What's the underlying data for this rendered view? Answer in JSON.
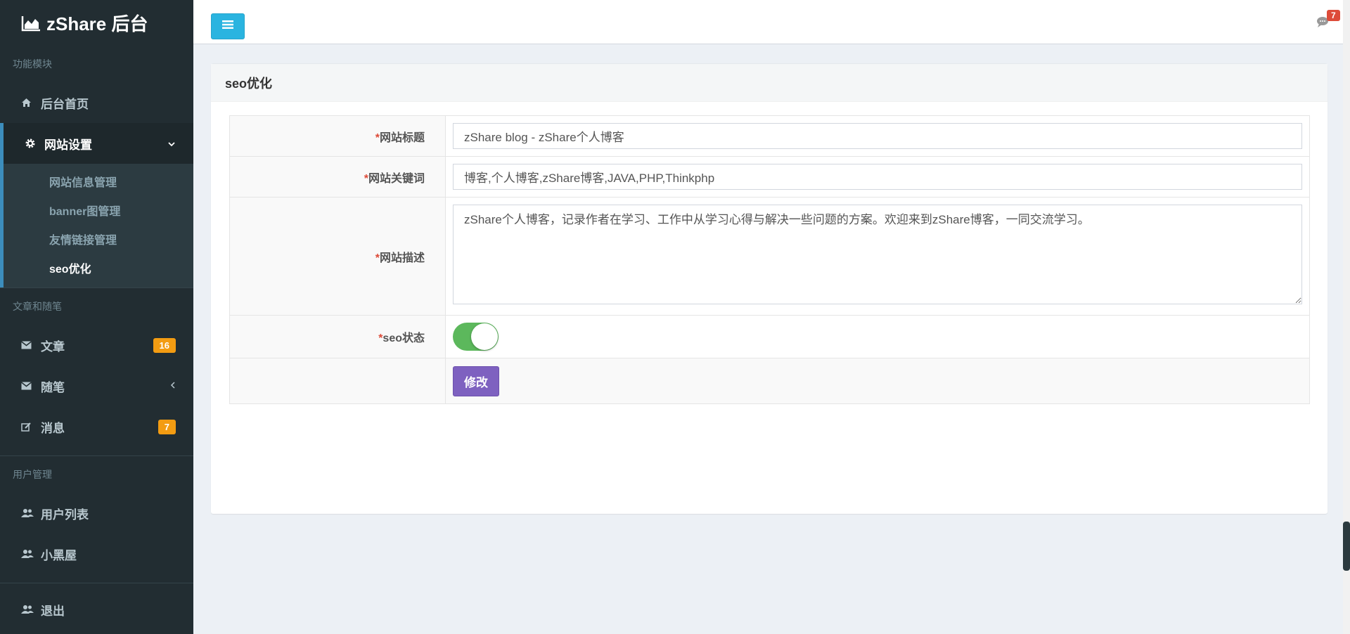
{
  "brand": {
    "title": "zShare 后台"
  },
  "sidebar": {
    "section1": "功能模块",
    "home": "后台首页",
    "site_settings": "网站设置",
    "submenu": [
      "网站信息管理",
      "banner图管理",
      "友情链接管理",
      "seo优化"
    ],
    "section2": "文章和随笔",
    "articles": {
      "label": "文章",
      "badge": "16"
    },
    "essays": "随笔",
    "messages": {
      "label": "消息",
      "badge": "7"
    },
    "section3": "用户管理",
    "users": "用户列表",
    "blacklist": "小黑屋",
    "logout": "退出"
  },
  "topbar": {
    "msg_count": "7"
  },
  "box": {
    "title": "seo优化"
  },
  "form": {
    "required_mark": "*",
    "site_title": {
      "label": "网站标题",
      "value": "zShare blog - zShare个人博客"
    },
    "keywords": {
      "label": "网站关键词",
      "value": "博客,个人博客,zShare博客,JAVA,PHP,Thinkphp"
    },
    "description": {
      "label": "网站描述",
      "value": "zShare个人博客，记录作者在学习、工作中从学习心得与解决一些问题的方案。欢迎来到zShare博客，一同交流学习。"
    },
    "seo_status": {
      "label": "seo状态",
      "enabled": true
    },
    "submit_label": "修改"
  },
  "colors": {
    "sidebar_bg": "#222d32",
    "accent": "#3c8dbc",
    "toggle_btn": "#2ab4e0",
    "switch_on": "#5cb85c",
    "submit": "#7e61c0",
    "badge": "#f39c12"
  }
}
